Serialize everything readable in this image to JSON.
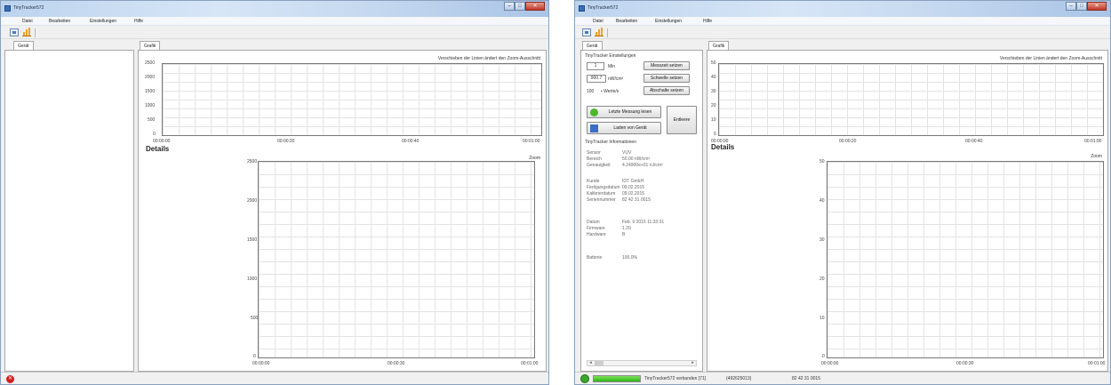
{
  "app": {
    "title": "TinyTracker572",
    "menus": [
      "Datei",
      "Bearbeiten",
      "Einstellungen",
      "Hilfe"
    ],
    "window_buttons": {
      "minimize": "–",
      "maximize": "□",
      "close": "✕"
    }
  },
  "left_window": {
    "left_tab": "Gerät",
    "graph_tab": "Grafik",
    "zoom_hint": "Verschieben der Linien ändert den Zoom-Ausschnitt",
    "overview_y_ticks": [
      "2500",
      "2000",
      "1500",
      "1000",
      "500",
      "0"
    ],
    "overview_x_ticks": [
      "00:00:00",
      "00:00:20",
      "00:00:40",
      "00:01:00"
    ],
    "details_title": "Details",
    "zoom_label": "Zoom",
    "details_y_ticks": [
      "2500",
      "2000",
      "1500",
      "1000",
      "500",
      "0"
    ],
    "details_x_ticks": [
      "00:00:00",
      "00:00:30",
      "00:01:00"
    ]
  },
  "right_window": {
    "left_tab": "Gerät",
    "graph_tab": "Grafik",
    "settings_title": "TinyTracker Einstellungen",
    "interval_value": "1",
    "interval_unit": "Min",
    "set_interval_button": "Messzeit setzen",
    "threshold_value": "900.7",
    "threshold_unit": "nW/cm²",
    "set_threshold_button": "Schwelle setzen",
    "values_count": "100",
    "values_label": "• Werte/s",
    "set_shutdown_button": "Abschalte setzen",
    "read_last_button": "Letzte Messung lesen",
    "load_graph_button": "Laden von Gerät",
    "delete_button": "Entleere",
    "info_title": "TinyTracker Informationen",
    "info": [
      {
        "k": "Sensor",
        "v": "VUV"
      },
      {
        "k": "Bereich",
        "v": "50.00 nW/cm²"
      },
      {
        "k": "Genauigkeit",
        "v": "4.24900e+01 nJ/cm²"
      },
      {
        "k": "",
        "v": ""
      },
      {
        "k": "Kunde",
        "v": "IOT GmbH"
      },
      {
        "k": "Fertigungsdatum",
        "v": "09.02.2015"
      },
      {
        "k": "Kalibrierdatum",
        "v": "09.02.2015"
      },
      {
        "k": "Seriennummer",
        "v": "82 42 31 0015"
      },
      {
        "k": "",
        "v": ""
      },
      {
        "k": "Datum",
        "v": "Feb. 9 2015 11:33:31"
      },
      {
        "k": "Firmware",
        "v": "1.20"
      },
      {
        "k": "Hardware",
        "v": "B"
      },
      {
        "k": "",
        "v": ""
      },
      {
        "k": "Batterie",
        "v": "100.0%"
      }
    ],
    "zoom_hint": "Verschieben der Linien ändert den Zoom-Ausschnitt",
    "overview_y_ticks": [
      "50",
      "40",
      "30",
      "20",
      "10",
      "0"
    ],
    "overview_x_ticks": [
      "00:00:00",
      "00:00:20",
      "00:00:40",
      "00:01:00"
    ],
    "details_title": "Details",
    "zoom_label": "Zoom",
    "details_y_ticks": [
      "50",
      "40",
      "30",
      "20",
      "10",
      "0"
    ],
    "details_x_ticks": [
      "00:00:00",
      "00:00:30",
      "00:01:00"
    ],
    "status_connected": "TinyTracker572 verbunden [71]",
    "status_device": "(492625013)",
    "status_serial": "82 42 31 0015",
    "battery_level": 1.0
  },
  "colors": {
    "title_gradient_start": "#bcd3ee",
    "close_red": "#c0392b",
    "status_error": "#d21f1f",
    "status_ok": "#39a82c",
    "progress_green": "#2ab614"
  }
}
